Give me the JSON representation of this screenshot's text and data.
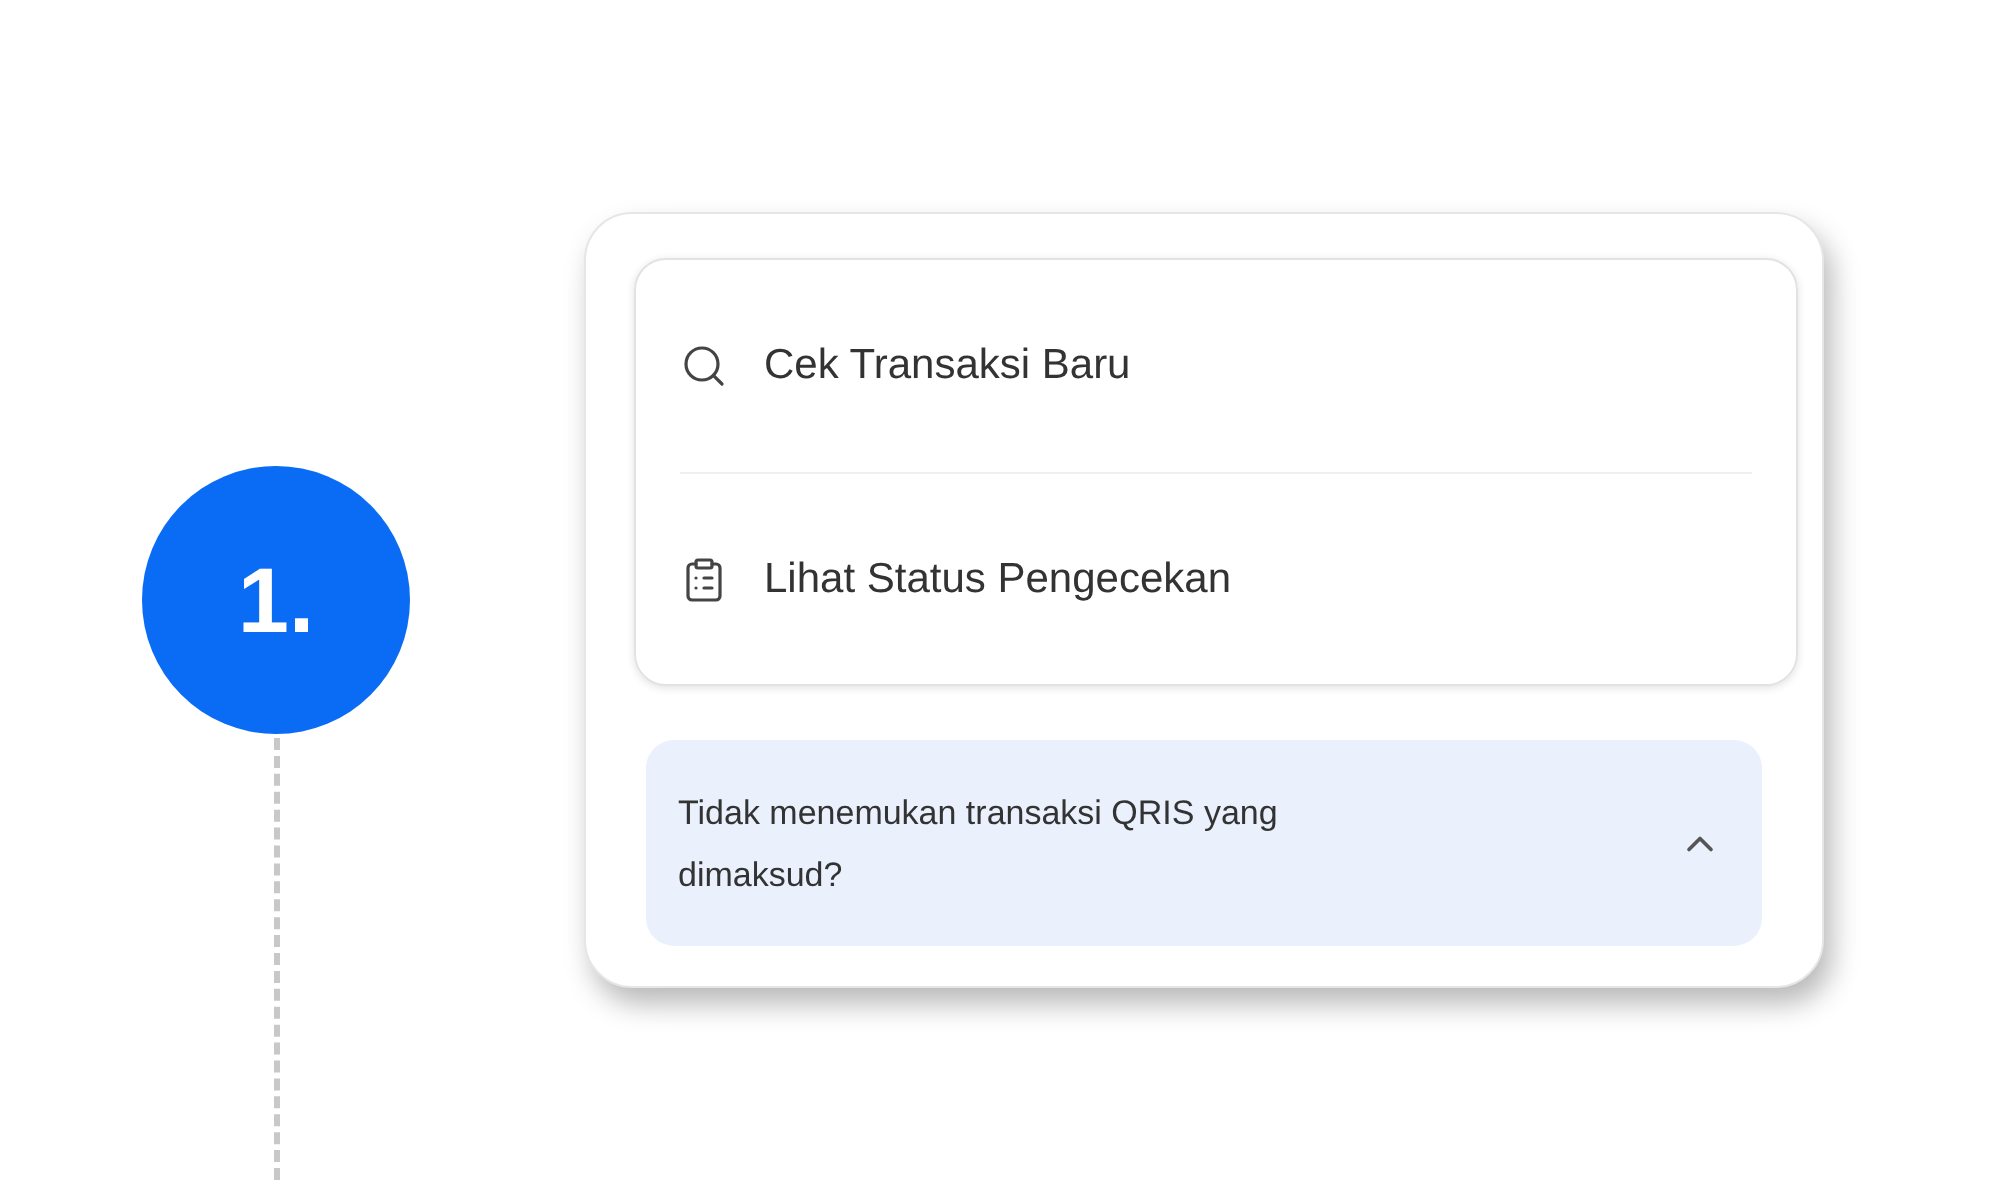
{
  "step": {
    "number": "1."
  },
  "menu": [
    {
      "kind": "search",
      "label": "Cek Transaksi Baru"
    },
    {
      "kind": "clipboard",
      "label": "Lihat Status Pengecekan"
    }
  ],
  "help": {
    "text": "Tidak menemukan transaksi QRIS yang dimaksud?",
    "expanded": true
  }
}
